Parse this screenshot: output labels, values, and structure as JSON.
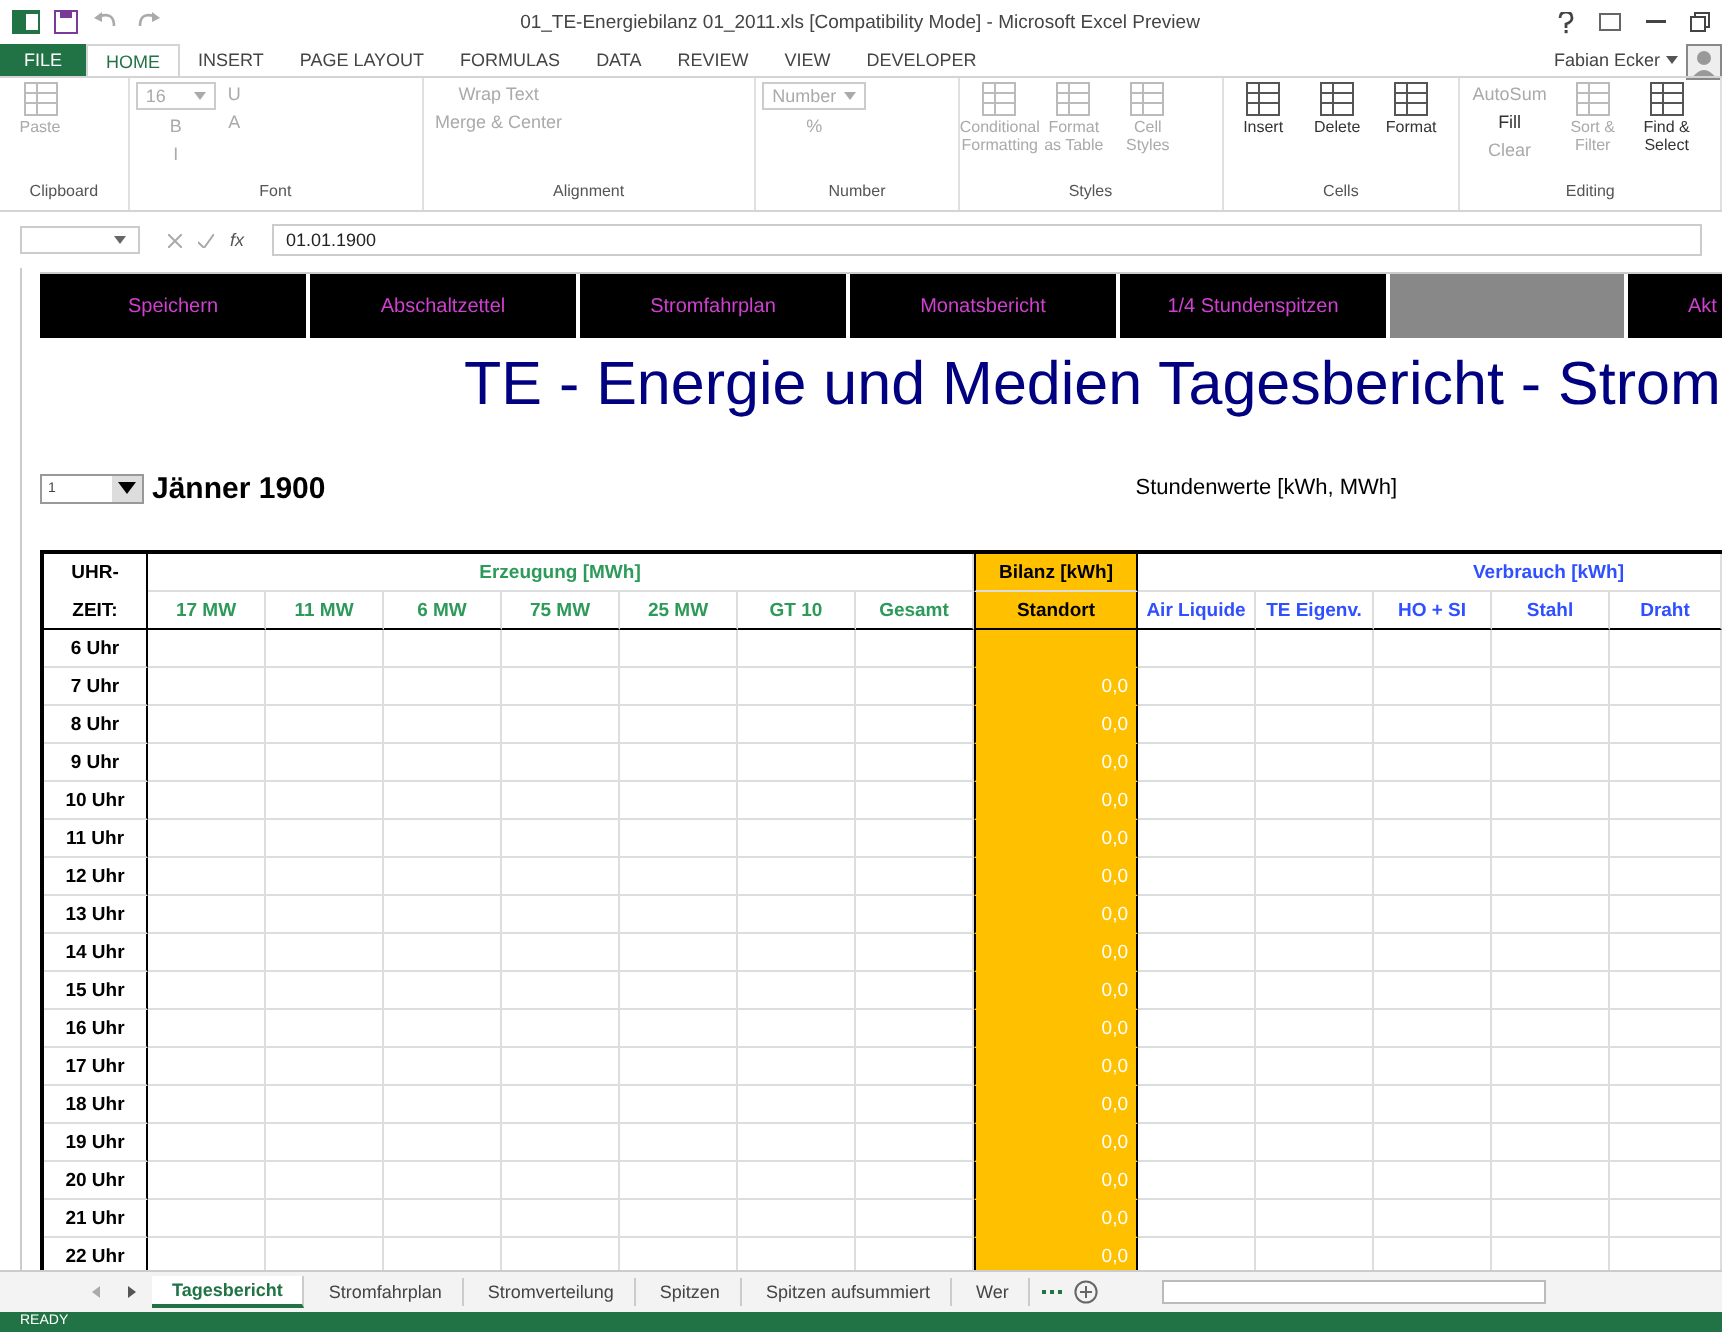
{
  "window": {
    "title": "01_TE-Energiebilanz 01_2011.xls  [Compatibility Mode] - Microsoft Excel Preview",
    "user": "Fabian Ecker"
  },
  "ribbon_tabs": [
    {
      "label": "FILE",
      "kind": "file",
      "selected": false
    },
    {
      "label": "HOME",
      "kind": "tab",
      "selected": true
    },
    {
      "label": "INSERT",
      "kind": "tab",
      "selected": false
    },
    {
      "label": "PAGE LAYOUT",
      "kind": "tab",
      "selected": false
    },
    {
      "label": "FORMULAS",
      "kind": "tab",
      "selected": false
    },
    {
      "label": "DATA",
      "kind": "tab",
      "selected": false
    },
    {
      "label": "REVIEW",
      "kind": "tab",
      "selected": false
    },
    {
      "label": "VIEW",
      "kind": "tab",
      "selected": false
    },
    {
      "label": "DEVELOPER",
      "kind": "tab",
      "selected": false
    }
  ],
  "ribbon_groups": [
    {
      "name": "Clipboard",
      "commands": [
        {
          "label": "Paste",
          "kind": "large",
          "disabled": true
        }
      ]
    },
    {
      "name": "Font",
      "commands": [
        {
          "label": "16",
          "kind": "field",
          "disabled": true
        },
        {
          "label": "B",
          "kind": "small",
          "disabled": true
        },
        {
          "label": "I",
          "kind": "small",
          "disabled": true
        },
        {
          "label": "U",
          "kind": "small",
          "disabled": true
        },
        {
          "label": "A",
          "kind": "small",
          "disabled": true
        }
      ]
    },
    {
      "name": "Alignment",
      "commands": [
        {
          "label": "Wrap Text",
          "kind": "small",
          "disabled": true
        },
        {
          "label": "Merge & Center",
          "kind": "small",
          "disabled": true
        }
      ]
    },
    {
      "name": "Number",
      "commands": [
        {
          "label": "Number",
          "kind": "field",
          "disabled": true
        },
        {
          "label": "%",
          "kind": "small",
          "disabled": true
        }
      ]
    },
    {
      "name": "Styles",
      "commands": [
        {
          "label": "Conditional Formatting",
          "kind": "large",
          "disabled": true
        },
        {
          "label": "Format as Table",
          "kind": "large",
          "disabled": true
        },
        {
          "label": "Cell Styles",
          "kind": "large",
          "disabled": true
        }
      ]
    },
    {
      "name": "Cells",
      "commands": [
        {
          "label": "Insert",
          "kind": "large",
          "disabled": false
        },
        {
          "label": "Delete",
          "kind": "large",
          "disabled": false
        },
        {
          "label": "Format",
          "kind": "large",
          "disabled": false
        }
      ]
    },
    {
      "name": "Editing",
      "commands": [
        {
          "label": "AutoSum",
          "kind": "small",
          "disabled": true
        },
        {
          "label": "Fill",
          "kind": "small",
          "disabled": false
        },
        {
          "label": "Clear",
          "kind": "small",
          "disabled": true
        },
        {
          "label": "Sort & Filter",
          "kind": "large",
          "disabled": true
        },
        {
          "label": "Find & Select",
          "kind": "large",
          "disabled": false
        }
      ]
    }
  ],
  "formula_bar": {
    "function_label": "fx",
    "value": "01.01.1900"
  },
  "macro_buttons": [
    {
      "label": "Speichern",
      "kind": "button"
    },
    {
      "label": "Abschaltzettel",
      "kind": "button"
    },
    {
      "label": "Stromfahrplan",
      "kind": "button"
    },
    {
      "label": "Monatsbericht",
      "kind": "button"
    },
    {
      "label": "1/4 Stundenspitzen",
      "kind": "button"
    },
    {
      "kind": "blank"
    },
    {
      "label": "Akt",
      "kind": "button"
    }
  ],
  "report_title": "TE - Energie und Medien Tagesbericht - Strom",
  "month_select": {
    "value": "1"
  },
  "month_label": "Jänner 1900",
  "units": "Stundenwerte [kWh, MWh]",
  "table": {
    "time_header": [
      "UHR-",
      "ZEIT:"
    ],
    "groups": [
      {
        "label": "Erzeugung [MWh]",
        "kind": "generation",
        "columns": [
          "17 MW",
          "11 MW",
          "6 MW",
          "75 MW",
          "25 MW",
          "GT 10",
          "Gesamt"
        ]
      },
      {
        "label": "Bilanz [kWh]",
        "kind": "balance",
        "columns": [
          "Standort"
        ]
      },
      {
        "label": "Verbrauch [kWh]",
        "kind": "consumption",
        "columns": [
          "Air Liquide",
          "TE Eigenv.",
          "HO + SI",
          "Stahl",
          "Draht"
        ]
      }
    ],
    "rows": [
      {
        "time": "6 Uhr"
      },
      {
        "time": "7 Uhr",
        "balance": "0,0"
      },
      {
        "time": "8 Uhr",
        "balance": "0,0"
      },
      {
        "time": "9 Uhr",
        "balance": "0,0"
      },
      {
        "time": "10 Uhr",
        "balance": "0,0"
      },
      {
        "time": "11 Uhr",
        "balance": "0,0"
      },
      {
        "time": "12 Uhr",
        "balance": "0,0"
      },
      {
        "time": "13 Uhr",
        "balance": "0,0"
      },
      {
        "time": "14 Uhr",
        "balance": "0,0"
      },
      {
        "time": "15 Uhr",
        "balance": "0,0"
      },
      {
        "time": "16 Uhr",
        "balance": "0,0"
      },
      {
        "time": "17 Uhr",
        "balance": "0,0"
      },
      {
        "time": "18 Uhr",
        "balance": "0,0"
      },
      {
        "time": "19 Uhr",
        "balance": "0,0"
      },
      {
        "time": "20 Uhr",
        "balance": "0,0"
      },
      {
        "time": "21 Uhr",
        "balance": "0,0"
      },
      {
        "time": "22 Uhr",
        "balance": "0,0"
      }
    ]
  },
  "sheet_tabs": [
    {
      "label": "Tagesbericht",
      "selected": true
    },
    {
      "label": "Stromfahrplan",
      "selected": false
    },
    {
      "label": "Stromverteilung",
      "selected": false
    },
    {
      "label": "Spitzen",
      "selected": false
    },
    {
      "label": "Spitzen aufsummiert",
      "selected": false
    },
    {
      "label": "Wer",
      "selected": false
    }
  ],
  "status": "READY"
}
